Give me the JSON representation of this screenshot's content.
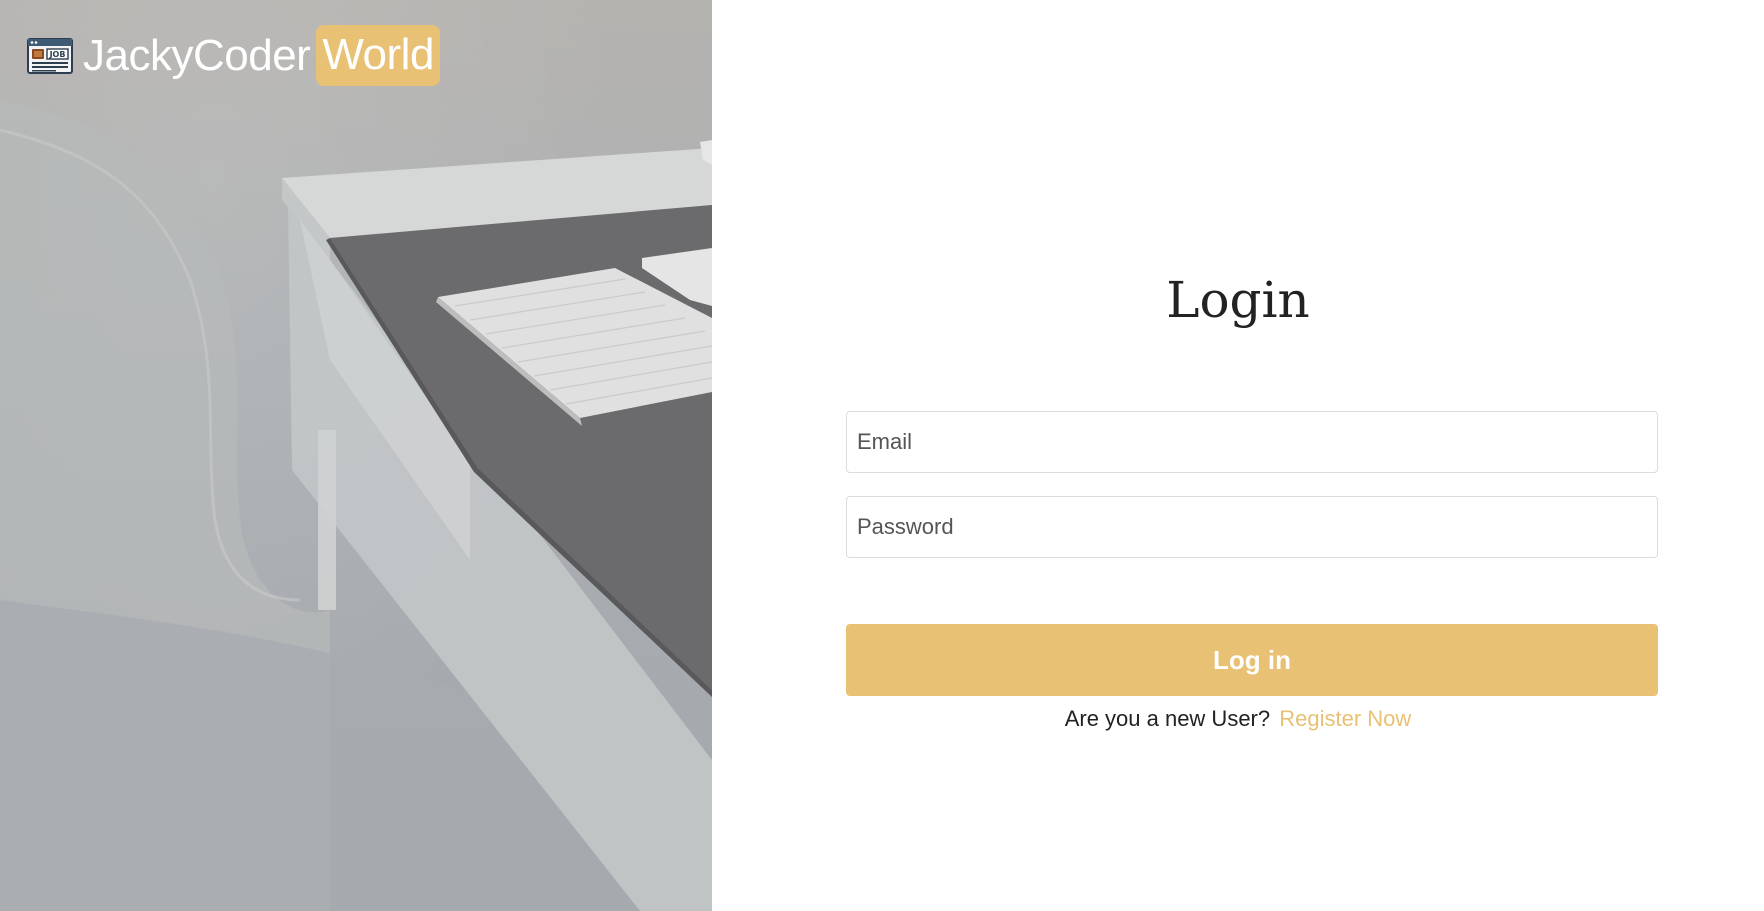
{
  "brand": {
    "name": "JackyCoder",
    "accent": "World",
    "logo_icon": "job-board-icon",
    "accent_color": "#e8c174"
  },
  "login": {
    "title": "Login",
    "email_placeholder": "Email",
    "password_placeholder": "Password",
    "email_value": "",
    "password_value": "",
    "submit_label": "Log in",
    "register_prompt": "Are you a new User?",
    "register_link": "Register Now",
    "button_color": "#e8c174"
  }
}
